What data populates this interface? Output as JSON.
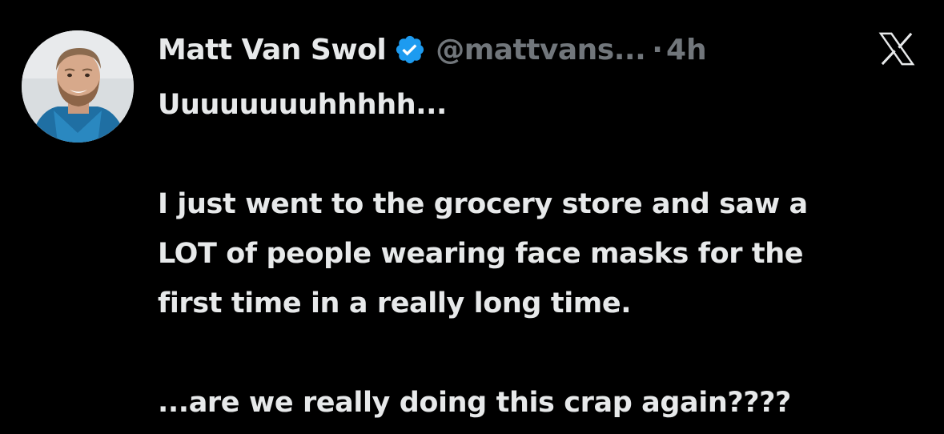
{
  "tweet": {
    "author_name": "Matt Van Swol",
    "verified_icon": "verified-badge-icon",
    "handle": "@mattvans...",
    "separator": "·",
    "timestamp": "4h",
    "platform_icon": "x-logo-icon",
    "text_lines": [
      "Uuuuuuuuhhhhh...",
      "",
      "I just went to the grocery store and saw a",
      "LOT of people wearing face masks for the",
      "first time in a really long time.",
      "",
      "...are we really doing this crap again????"
    ]
  },
  "colors": {
    "background": "#000000",
    "text_primary": "#e7e9ea",
    "text_secondary": "#71767b",
    "verified_blue": "#1d9bf0"
  }
}
